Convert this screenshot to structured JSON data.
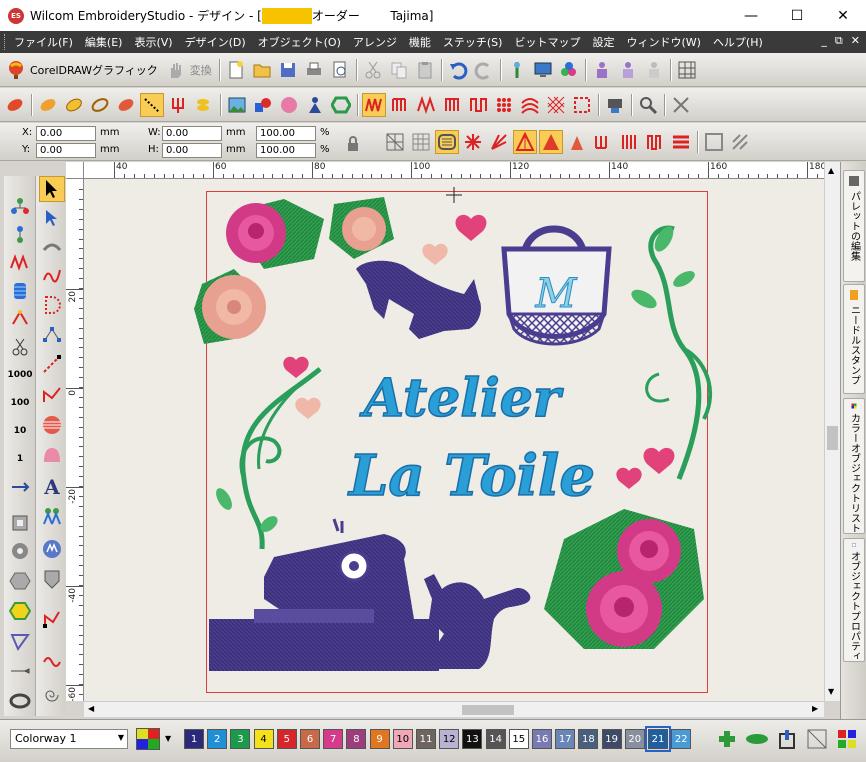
{
  "window": {
    "app_title": "Wilcom EmbroideryStudio - デザイン - [",
    "title_mid": "オーダー",
    "title_end": "Tajima]",
    "minimize": "—",
    "maximize": "☐",
    "close": "✕"
  },
  "menu": [
    "ファイル(F)",
    "編集(E)",
    "表示(V)",
    "デザイン(D)",
    "オブジェクト(O)",
    "アレンジ",
    "機能",
    "ステッチ(S)",
    "ビットマップ",
    "設定",
    "ウィンドウ(W)",
    "ヘルプ(H)"
  ],
  "mdi": {
    "min": "_",
    "restore": "⧉",
    "close": "✕"
  },
  "toolbar": {
    "coreldraw_label": "CorelDRAWグラフィック",
    "convert_label": "変換"
  },
  "props": {
    "x_label": "X:",
    "x_value": "0.00",
    "y_label": "Y:",
    "y_value": "0.00",
    "w_label": "W:",
    "w_value": "0.00",
    "h_label": "H:",
    "h_value": "0.00",
    "unit": "mm",
    "sx_value": "100.00",
    "sy_value": "100.00",
    "pct": "%"
  },
  "ruler_h": [
    "40",
    "60",
    "80",
    "100",
    "120",
    "140",
    "160",
    "180"
  ],
  "ruler_v": [
    "20",
    "0",
    "-20",
    "-40",
    "-60"
  ],
  "design": {
    "line1": "Atelier",
    "line2": "La Toile",
    "monogram": "M"
  },
  "right_tabs": [
    "パレットの編集",
    "ニードルスタンプ",
    "カラーオブジェクトリスト",
    "オブジェクトプロパティ"
  ],
  "colorway": {
    "value": "Colorway 1"
  },
  "palette": [
    {
      "n": "1",
      "c": "#2b2a7a",
      "t": "#fff"
    },
    {
      "n": "2",
      "c": "#1f8fd6",
      "t": "#fff"
    },
    {
      "n": "3",
      "c": "#1a9a4a",
      "t": "#fff"
    },
    {
      "n": "4",
      "c": "#f3e21b",
      "t": "#000"
    },
    {
      "n": "5",
      "c": "#d6262b",
      "t": "#fff"
    },
    {
      "n": "6",
      "c": "#c76a4a",
      "t": "#fff"
    },
    {
      "n": "7",
      "c": "#d63a8a",
      "t": "#fff"
    },
    {
      "n": "8",
      "c": "#9c3e7c",
      "t": "#fff"
    },
    {
      "n": "9",
      "c": "#e0761e",
      "t": "#fff"
    },
    {
      "n": "10",
      "c": "#f0a8b6",
      "t": "#000"
    },
    {
      "n": "11",
      "c": "#6e6460",
      "t": "#fff"
    },
    {
      "n": "12",
      "c": "#b9b2d2",
      "t": "#000"
    },
    {
      "n": "13",
      "c": "#111111",
      "t": "#fff"
    },
    {
      "n": "14",
      "c": "#555555",
      "t": "#fff"
    },
    {
      "n": "15",
      "c": "#ffffff",
      "t": "#000"
    },
    {
      "n": "16",
      "c": "#7a7ab2",
      "t": "#fff"
    },
    {
      "n": "17",
      "c": "#6a86b6",
      "t": "#fff"
    },
    {
      "n": "18",
      "c": "#48607e",
      "t": "#fff"
    },
    {
      "n": "19",
      "c": "#3e4a66",
      "t": "#fff"
    },
    {
      "n": "20",
      "c": "#8890a0",
      "t": "#fff"
    },
    {
      "n": "21",
      "c": "#1f5fa0",
      "t": "#fff"
    },
    {
      "n": "22",
      "c": "#4a9ad6",
      "t": "#fff"
    }
  ]
}
